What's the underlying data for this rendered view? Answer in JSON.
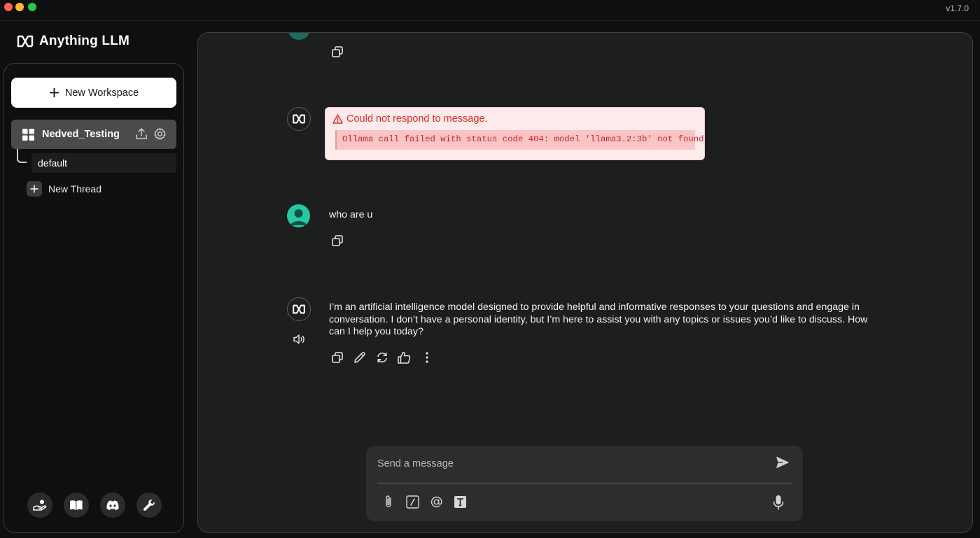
{
  "window": {
    "version": "v1.7.0"
  },
  "brand": {
    "name": "Anything LLM"
  },
  "sidebar": {
    "new_workspace_label": "New Workspace",
    "workspace": {
      "name": "Nedved_Testing"
    },
    "threads": [
      {
        "label": "default"
      }
    ],
    "new_thread_label": "New Thread",
    "footer_icons": [
      "community-hub-icon",
      "docs-icon",
      "discord-icon",
      "settings-icon"
    ]
  },
  "chat": {
    "messages": [
      {
        "role": "assistant",
        "error_title": "Could not respond to message.",
        "error_detail": "Ollama call failed with status code 404: model 'llama3.2:3b' not found"
      },
      {
        "role": "user",
        "text": "who are u"
      },
      {
        "role": "assistant",
        "text": "I’m an artificial intelligence model designed to provide helpful and informative responses to your questions and engage in conversation. I don’t have a personal identity, but I’m here to assist you with any topics or issues you’d like to discuss. How can I help you today?"
      }
    ]
  },
  "composer": {
    "placeholder": "Send a message",
    "value": ""
  },
  "colors": {
    "accent_user": "#25c9a3",
    "error_bg": "#fdebec",
    "error_text": "#d92d20"
  }
}
